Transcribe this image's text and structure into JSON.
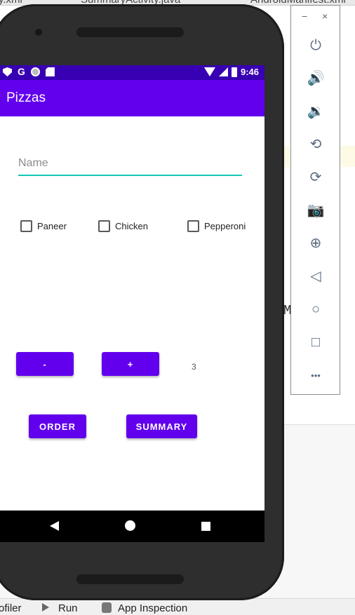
{
  "ide": {
    "tabs": [
      "y.xml",
      "SummaryActivity.java",
      "AndroidManifest.xml"
    ],
    "code_fragment": "M    iv",
    "bottom_tools": [
      "ofiler",
      "Run",
      "App Inspection"
    ]
  },
  "status_bar": {
    "time": "9:46",
    "icons": [
      "shield-icon",
      "google-icon",
      "circle-icon",
      "sd-card-icon",
      "wifi-icon",
      "signal-icon",
      "battery-icon"
    ]
  },
  "app_bar": {
    "title": "Pizzas"
  },
  "form": {
    "name_placeholder": "Name",
    "name_value": "",
    "toppings": [
      {
        "label": "Paneer",
        "checked": false
      },
      {
        "label": "Chicken",
        "checked": false
      },
      {
        "label": "Pepperoni",
        "checked": false
      }
    ],
    "decrement_label": "-",
    "increment_label": "+",
    "quantity": "3",
    "order_label": "ORDER",
    "summary_label": "SUMMARY"
  },
  "emulator_panel": {
    "minimize_glyph": "−",
    "close_glyph": "×",
    "buttons": [
      "power-icon",
      "volume-up-icon",
      "volume-down-icon",
      "rotate-left-icon",
      "rotate-right-icon",
      "camera-icon",
      "zoom-icon",
      "back-icon",
      "home-icon",
      "overview-icon",
      "more-icon"
    ],
    "glyphs": [
      "⏻",
      "🔊",
      "🔉",
      "⟲",
      "⟳",
      "📷",
      "⊕",
      "◁",
      "○",
      "□",
      "•••"
    ]
  },
  "colors": {
    "primary": "#6200ee",
    "primary_dark": "#3700b3",
    "accent": "#17c7b4"
  }
}
